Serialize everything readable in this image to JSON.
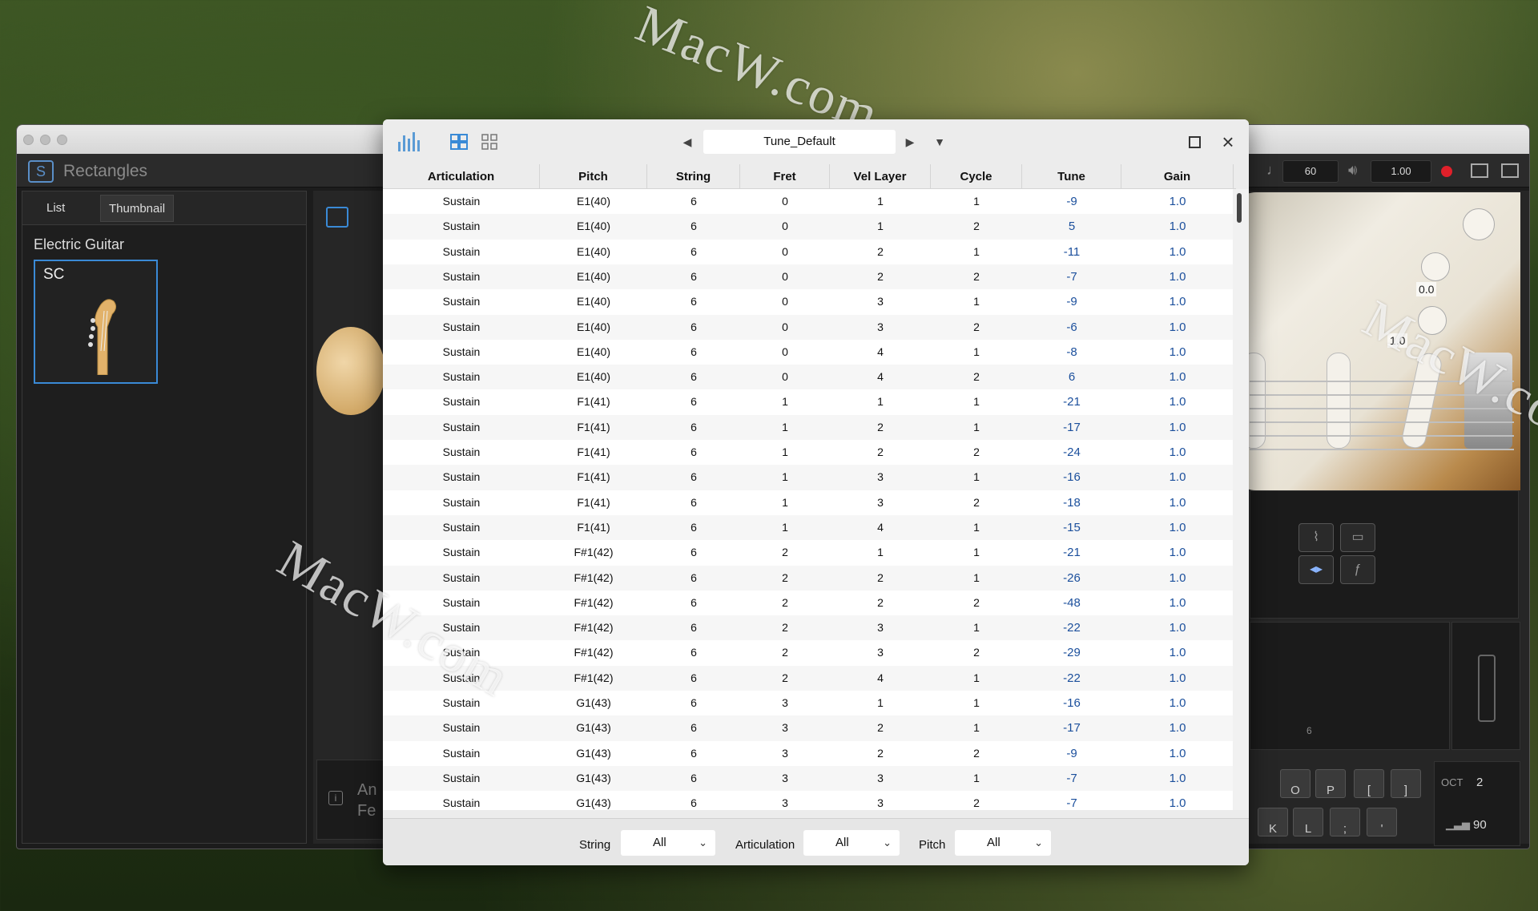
{
  "app": {
    "name": "Rectangles",
    "tempo": "60",
    "volume": "1.00",
    "sidebar": {
      "tabs": [
        "List",
        "Thumbnail"
      ],
      "category": "Electric Guitar",
      "preset_thumb": "SC"
    },
    "guitar": {
      "knob1": "0.0",
      "knob2": "1.0",
      "meter_label": "6"
    },
    "info_text": [
      "An",
      "Fe"
    ],
    "keyboard": {
      "keys_row1": [
        "O",
        "P",
        "[",
        "]"
      ],
      "keys_row2": [
        "K",
        "L",
        ";",
        "'"
      ],
      "oct_label": "OCT",
      "oct_value": "2",
      "velocity": "90"
    }
  },
  "watermarks": [
    "MacW.com",
    "MacW.com",
    "MacW.com"
  ],
  "dialog": {
    "preset_name": "Tune_Default",
    "icons": [
      "equalizer-icon",
      "grid-view-icon",
      "small-grid-icon",
      "prev-arrow-icon",
      "next-arrow-icon",
      "dropdown-icon",
      "maximize-icon",
      "close-icon"
    ],
    "columns": [
      "Articulation",
      "Pitch",
      "String",
      "Fret",
      "Vel Layer",
      "Cycle",
      "Tune",
      "Gain"
    ],
    "rows": [
      [
        "Sustain",
        "E1(40)",
        "6",
        "0",
        "1",
        "1",
        "-9",
        "1.0"
      ],
      [
        "Sustain",
        "E1(40)",
        "6",
        "0",
        "1",
        "2",
        "5",
        "1.0"
      ],
      [
        "Sustain",
        "E1(40)",
        "6",
        "0",
        "2",
        "1",
        "-11",
        "1.0"
      ],
      [
        "Sustain",
        "E1(40)",
        "6",
        "0",
        "2",
        "2",
        "-7",
        "1.0"
      ],
      [
        "Sustain",
        "E1(40)",
        "6",
        "0",
        "3",
        "1",
        "-9",
        "1.0"
      ],
      [
        "Sustain",
        "E1(40)",
        "6",
        "0",
        "3",
        "2",
        "-6",
        "1.0"
      ],
      [
        "Sustain",
        "E1(40)",
        "6",
        "0",
        "4",
        "1",
        "-8",
        "1.0"
      ],
      [
        "Sustain",
        "E1(40)",
        "6",
        "0",
        "4",
        "2",
        "6",
        "1.0"
      ],
      [
        "Sustain",
        "F1(41)",
        "6",
        "1",
        "1",
        "1",
        "-21",
        "1.0"
      ],
      [
        "Sustain",
        "F1(41)",
        "6",
        "1",
        "2",
        "1",
        "-17",
        "1.0"
      ],
      [
        "Sustain",
        "F1(41)",
        "6",
        "1",
        "2",
        "2",
        "-24",
        "1.0"
      ],
      [
        "Sustain",
        "F1(41)",
        "6",
        "1",
        "3",
        "1",
        "-16",
        "1.0"
      ],
      [
        "Sustain",
        "F1(41)",
        "6",
        "1",
        "3",
        "2",
        "-18",
        "1.0"
      ],
      [
        "Sustain",
        "F1(41)",
        "6",
        "1",
        "4",
        "1",
        "-15",
        "1.0"
      ],
      [
        "Sustain",
        "F#1(42)",
        "6",
        "2",
        "1",
        "1",
        "-21",
        "1.0"
      ],
      [
        "Sustain",
        "F#1(42)",
        "6",
        "2",
        "2",
        "1",
        "-26",
        "1.0"
      ],
      [
        "Sustain",
        "F#1(42)",
        "6",
        "2",
        "2",
        "2",
        "-48",
        "1.0"
      ],
      [
        "Sustain",
        "F#1(42)",
        "6",
        "2",
        "3",
        "1",
        "-22",
        "1.0"
      ],
      [
        "Sustain",
        "F#1(42)",
        "6",
        "2",
        "3",
        "2",
        "-29",
        "1.0"
      ],
      [
        "Sustain",
        "F#1(42)",
        "6",
        "2",
        "4",
        "1",
        "-22",
        "1.0"
      ],
      [
        "Sustain",
        "G1(43)",
        "6",
        "3",
        "1",
        "1",
        "-16",
        "1.0"
      ],
      [
        "Sustain",
        "G1(43)",
        "6",
        "3",
        "2",
        "1",
        "-17",
        "1.0"
      ],
      [
        "Sustain",
        "G1(43)",
        "6",
        "3",
        "2",
        "2",
        "-9",
        "1.0"
      ],
      [
        "Sustain",
        "G1(43)",
        "6",
        "3",
        "3",
        "1",
        "-7",
        "1.0"
      ],
      [
        "Sustain",
        "G1(43)",
        "6",
        "3",
        "3",
        "2",
        "-7",
        "1.0"
      ]
    ],
    "filters": [
      {
        "label": "String",
        "value": "All"
      },
      {
        "label": "Articulation",
        "value": "All"
      },
      {
        "label": "Pitch",
        "value": "All"
      }
    ]
  },
  "colors": {
    "accent": "#3a8ad6",
    "value_blue": "#1b4f9c",
    "record": "#e0202a"
  }
}
